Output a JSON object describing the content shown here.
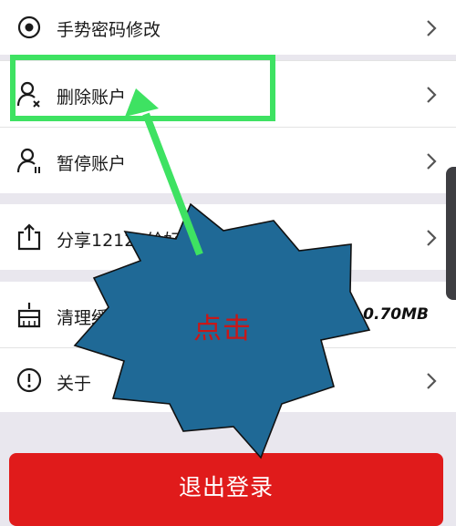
{
  "menu": {
    "items": [
      {
        "label": "手势密码修改",
        "icon": "target-icon"
      },
      {
        "label": "删除账户",
        "icon": "user-remove-icon"
      },
      {
        "label": "暂停账户",
        "icon": "user-pause-icon"
      },
      {
        "label": "分享12123给好友",
        "icon": "share-icon"
      },
      {
        "label": "清理缓存",
        "icon": "broom-icon",
        "value": "0.70MB"
      },
      {
        "label": "关于",
        "icon": "info-icon"
      }
    ]
  },
  "logout": {
    "label": "退出登录"
  },
  "annotation": {
    "text": "点击"
  },
  "colors": {
    "accent": "#3ee262",
    "logout": "#e01b1b",
    "starburst": "#1f6996",
    "annotation_text": "#c81818"
  }
}
